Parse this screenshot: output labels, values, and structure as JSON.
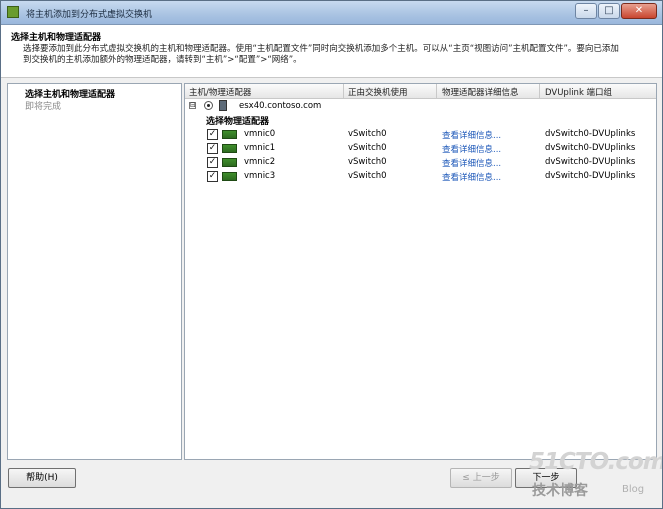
{
  "window": {
    "title": "将主机添加到分布式虚拟交换机",
    "min": "–",
    "max": "□",
    "close": "✕"
  },
  "header": {
    "title": "选择主机和物理适配器",
    "description": "选择要添加到此分布式虚拟交换机的主机和物理适配器。使用“主机配置文件”同时向交换机添加多个主机。可以从“主页“视图访问”主机配置文件”。要向已添加到交换机的主机添加额外的物理适配器，请转到“主机”>“配置”>“网络”。"
  },
  "nav": {
    "items": [
      {
        "label": "选择主机和物理适配器"
      },
      {
        "label": "即将完成"
      }
    ]
  },
  "table": {
    "headers": [
      "主机/物理适配器",
      "正由交换机使用",
      "物理适配器详细信息",
      "DVUplink 端口组"
    ],
    "host": {
      "expander": "⊟",
      "name": "esx40.contoso.com"
    },
    "group_label": "选择物理适配器",
    "rows": [
      {
        "check": "✓",
        "name": "vmnic0",
        "switch": "vSwitch0",
        "details": "查看详细信息...",
        "uplink": "dvSwitch0-DVUplinks"
      },
      {
        "check": "✓",
        "name": "vmnic1",
        "switch": "vSwitch0",
        "details": "查看详细信息...",
        "uplink": "dvSwitch0-DVUplinks"
      },
      {
        "check": "✓",
        "name": "vmnic2",
        "switch": "vSwitch0",
        "details": "查看详细信息...",
        "uplink": "dvSwitch0-DVUplinks"
      },
      {
        "check": "✓",
        "name": "vmnic3",
        "switch": "vSwitch0",
        "details": "查看详细信息...",
        "uplink": "dvSwitch0-DVUplinks"
      }
    ]
  },
  "footer": {
    "help": "帮助(H)",
    "back": "≤ 上一步",
    "next": "下一步"
  },
  "watermark": {
    "line1": "51CTO.com",
    "line2": "技术博客",
    "line3": "Blog"
  }
}
